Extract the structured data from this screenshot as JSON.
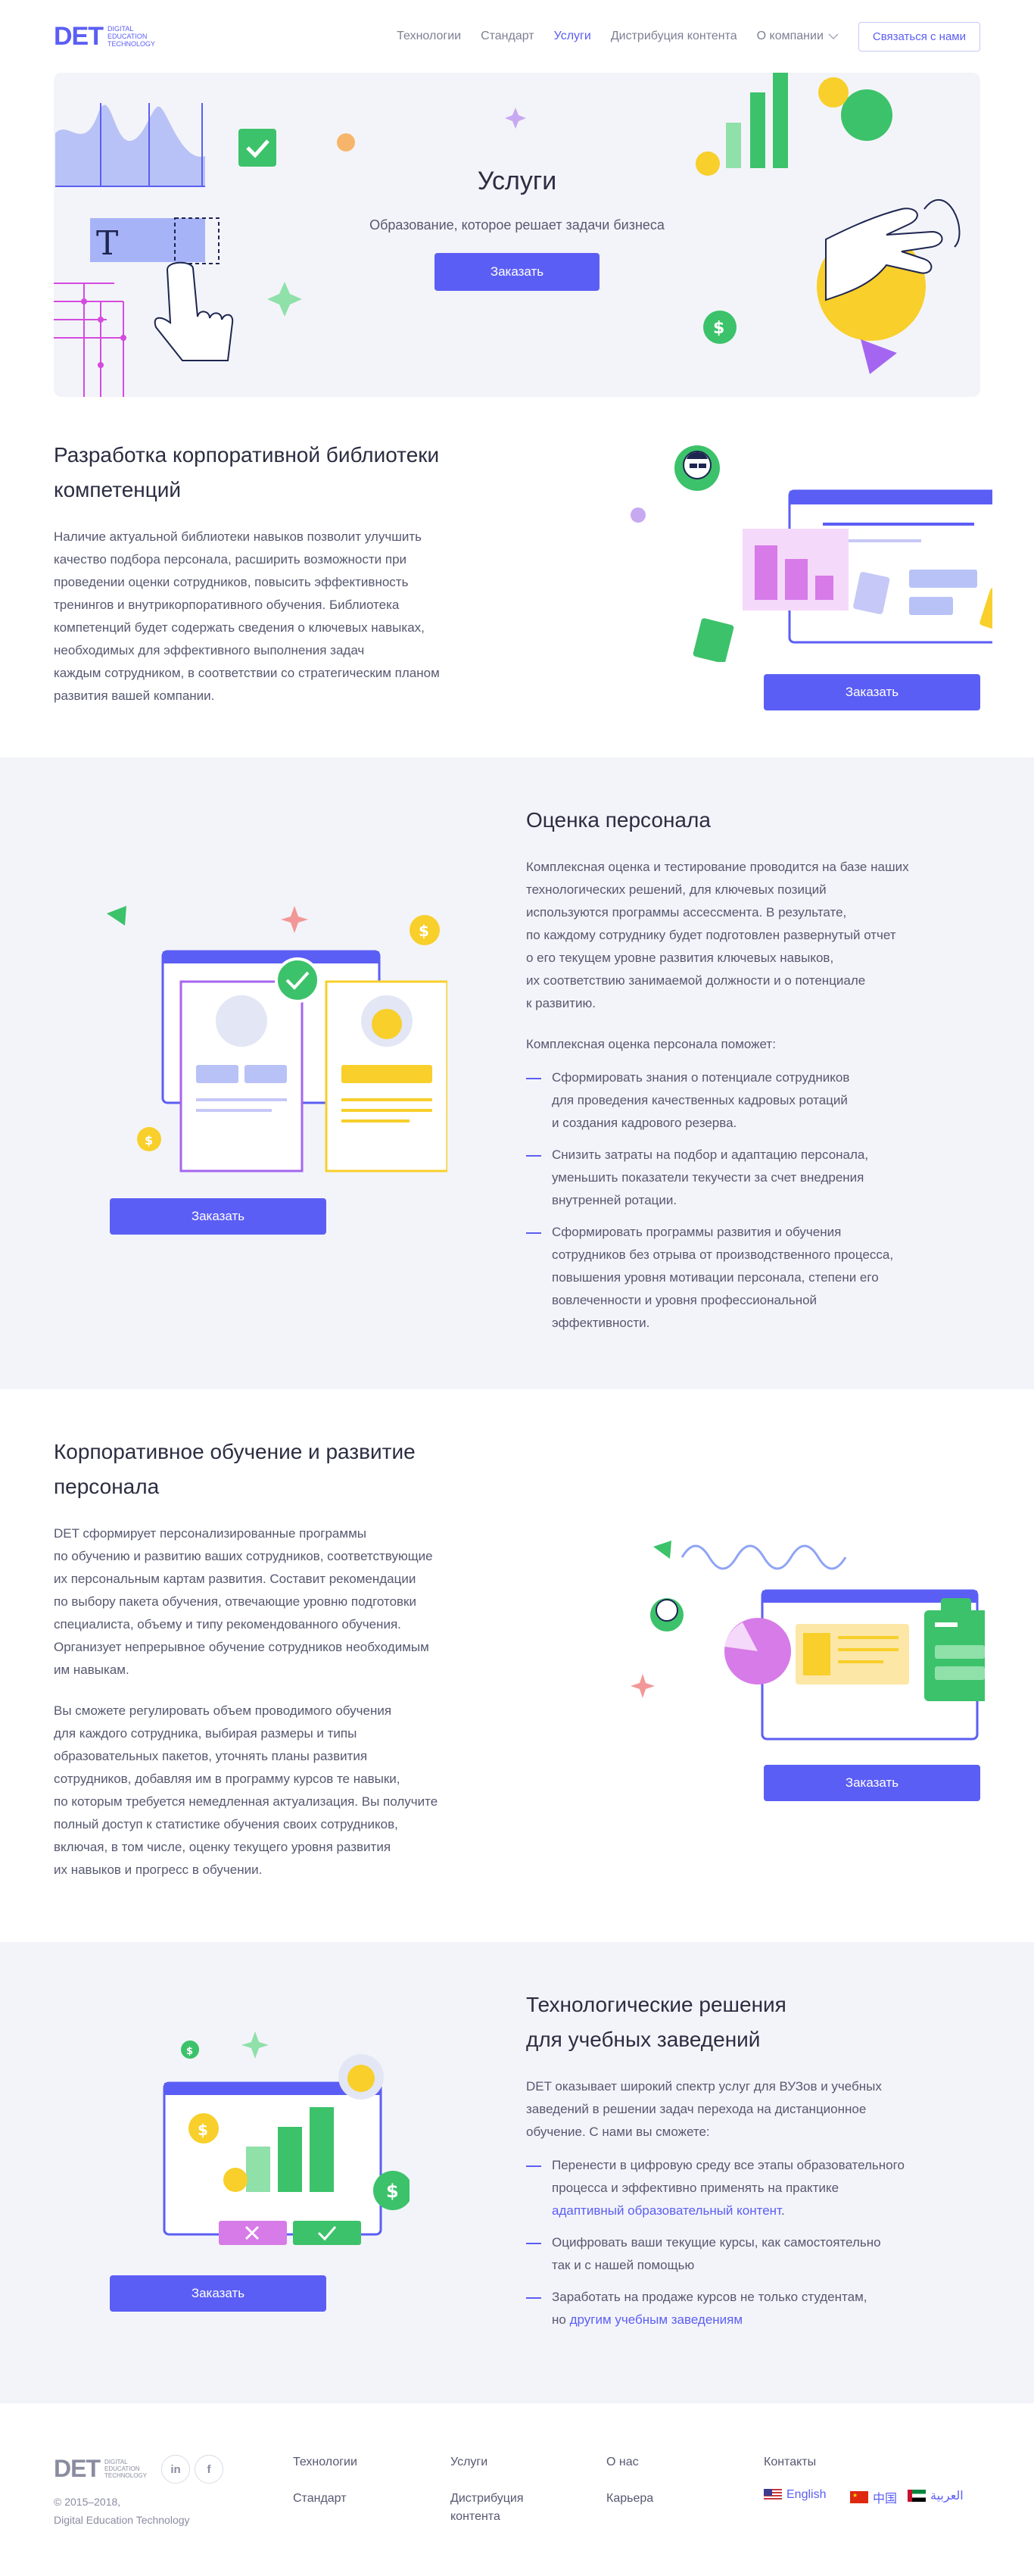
{
  "header": {
    "logo": "DET",
    "logo_sub": [
      "Digital",
      "Education",
      "Technology"
    ],
    "nav": [
      {
        "label": "Технологии"
      },
      {
        "label": "Стандарт"
      },
      {
        "label": "Услуги",
        "active": true
      },
      {
        "label": "Дистрибуция контента"
      },
      {
        "label": "О компании"
      }
    ],
    "contact_button": "Связаться с нами"
  },
  "hero": {
    "title": "Услуги",
    "subtitle": "Образование, которое решает задачи бизнеса",
    "button": "Заказать"
  },
  "sections": [
    {
      "title_lines": [
        "Разработка корпоративной библиотеки",
        "компетенций"
      ],
      "text_lines": [
        "Наличие актуальной библиотеки навыков позволит улучшить",
        "качество подбора персонала, расширить возможности при",
        "проведении оценки сотрудников, повысить эффективность",
        "тренингов и внутрикорпоративного обучения. Библиотека",
        "компетенций будет содержать сведения о ключевых навыках,",
        "необходимых для эффективного выполнения задач",
        "каждым сотрудником, в соответствии со стратегическим планом",
        "развития вашей компании."
      ],
      "button": "Заказать"
    },
    {
      "title": "Оценка персонала",
      "text_lines": [
        "Комплексная оценка и тестирование проводится на базе наших",
        "технологических решений, для ключевых позиций",
        "используются программы ассессмента. В результате,",
        "по каждому сотруднику будет подготовлен развернутый отчет",
        "о его текущем уровне развития ключевых навыков,",
        "их соответствию занимаемой должности и о потенциале",
        "к развитию."
      ],
      "list_intro": "Комплексная оценка персонала поможет:",
      "list": [
        [
          "Сформировать знания о потенциале сотрудников",
          "для проведения качественных кадровых ротаций",
          "и создания кадрового резерва."
        ],
        [
          "Снизить затраты на подбор и адаптацию персонала,",
          "уменьшить показатели текучести за счет внедрения",
          "внутренней ротации."
        ],
        [
          "Сформировать программы развития и обучения",
          "сотрудников без отрыва от производственного процесса,",
          "повышения уровня мотивации персонала, степени его",
          "вовлеченности и уровня профессиональной",
          "эффективности."
        ]
      ],
      "button": "Заказать"
    },
    {
      "title_lines": [
        "Корпоративное обучение и развитие",
        "персонала"
      ],
      "text_lines": [
        "DET сформирует персонализированные программы",
        "по обучению и развитию ваших сотрудников, соответствующие",
        "их персональным картам развития. Составит рекомендации",
        "по выбору пакета обучения, отвечающие уровню подготовки",
        "специалиста, объему и типу рекомендованного обучения.",
        "Организует непрерывное обучение сотрудников необходимым",
        "им навыкам."
      ],
      "text2_lines": [
        "Вы сможете регулировать объем проводимого обучения",
        "для каждого сотрудника, выбирая размеры и типы",
        "образовательных пакетов, уточнять планы развития",
        "сотрудников, добавляя им в программу курсов те навыки,",
        "по которым требуется немедленная актуализация. Вы получите",
        "полный доступ к статистике обучения своих сотрудников,",
        "включая, в том числе, оценку текущего уровня развития",
        "их навыков и прогресс в обучении."
      ],
      "button": "Заказать"
    },
    {
      "title_lines": [
        "Технологические решения",
        "для учебных заведений"
      ],
      "text_lines": [
        "DET оказывает широкий спектр услуг для ВУЗов и учебных",
        "заведений в решении задач перехода на дистанционное",
        "обучение. С нами вы сможете:"
      ],
      "list": [
        {
          "lines": [
            "Перенести в цифровую среду все этапы образовательного",
            "процесса и эффективно применять на практике"
          ],
          "link": "адаптивный образовательный контент",
          "after": "."
        },
        {
          "lines": [
            "Оцифровать ваши текущие курсы, как самостоятельно",
            "так и с нашей помощью"
          ]
        },
        {
          "lines": [
            "Заработать на продаже курсов не только студентам,"
          ],
          "prefix": "но ",
          "link": "другим учебным заведениям"
        }
      ],
      "button": "Заказать"
    }
  ],
  "footer": {
    "logo": "DET",
    "logo_sub": [
      "Digital",
      "Education",
      "Technology"
    ],
    "social": [
      "in",
      "f"
    ],
    "copyright": [
      "© 2015–2018,",
      "Digital Education Technology"
    ],
    "links": [
      "Технологии",
      "Стандарт",
      "Услуги",
      "Дистрибуция",
      "контента",
      "О нас",
      "Карьера",
      "Контакты"
    ],
    "langs": [
      "English",
      "中国",
      "العربية"
    ]
  },
  "colors": {
    "accent": "#5b5ef4",
    "grey_bg": "#f3f4f9",
    "green": "#3cc26a",
    "yellow": "#f8cf2b",
    "pink": "#d67be8"
  }
}
